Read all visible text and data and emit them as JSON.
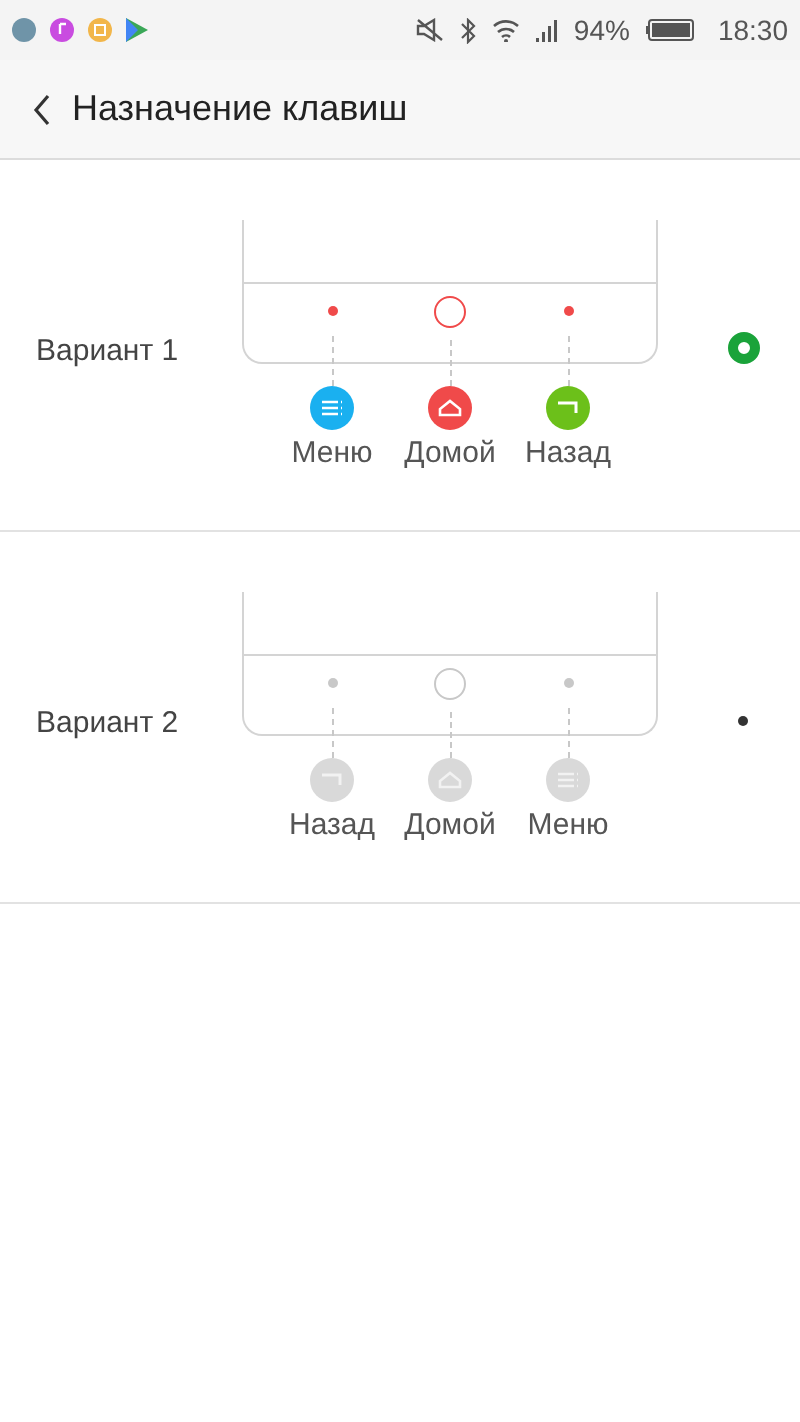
{
  "status_bar": {
    "battery": "94%",
    "time": "18:30"
  },
  "header": {
    "title": "Назначение клавиш"
  },
  "options": [
    {
      "label": "Вариант 1",
      "selected": true,
      "keys": [
        {
          "kind": "menu",
          "label": "Меню",
          "color": "#1ab0f0"
        },
        {
          "kind": "home",
          "label": "Домой",
          "color": "#f04a4a"
        },
        {
          "kind": "back",
          "label": "Назад",
          "color": "#6cc01a"
        }
      ]
    },
    {
      "label": "Вариант 2",
      "selected": false,
      "keys": [
        {
          "kind": "back",
          "label": "Назад"
        },
        {
          "kind": "home",
          "label": "Домой"
        },
        {
          "kind": "menu",
          "label": "Меню"
        }
      ]
    }
  ]
}
